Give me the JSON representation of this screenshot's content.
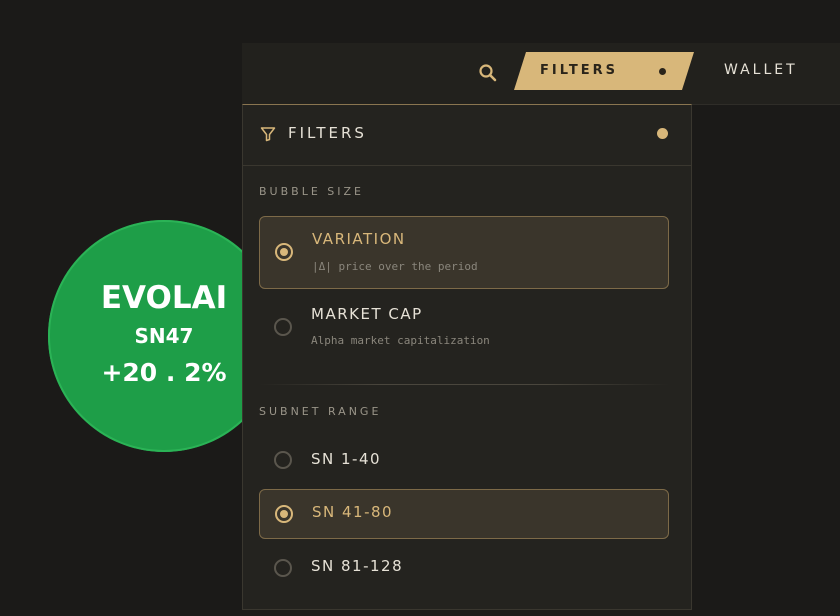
{
  "bubble": {
    "name": "EVOLAI",
    "subnet": "SN47",
    "change": "+20 . 2%",
    "color": "#1e9e48"
  },
  "topbar": {
    "search_icon": "search-icon",
    "filters_label": "FILTERS",
    "wallet_label": "WALLET",
    "accent_color": "#d8b77a"
  },
  "panel": {
    "title": "FILTERS",
    "bubble_size": {
      "label": "BUBBLE SIZE",
      "options": [
        {
          "title": "VARIATION",
          "subtitle": "|Δ| price over the period",
          "selected": true
        },
        {
          "title": "MARKET CAP",
          "subtitle": "Alpha market capitalization",
          "selected": false
        }
      ]
    },
    "subnet_range": {
      "label": "SUBNET RANGE",
      "options": [
        {
          "title": "SN 1-40",
          "selected": false
        },
        {
          "title": "SN 41-80",
          "selected": true
        },
        {
          "title": "SN 81-128",
          "selected": false
        }
      ]
    }
  }
}
